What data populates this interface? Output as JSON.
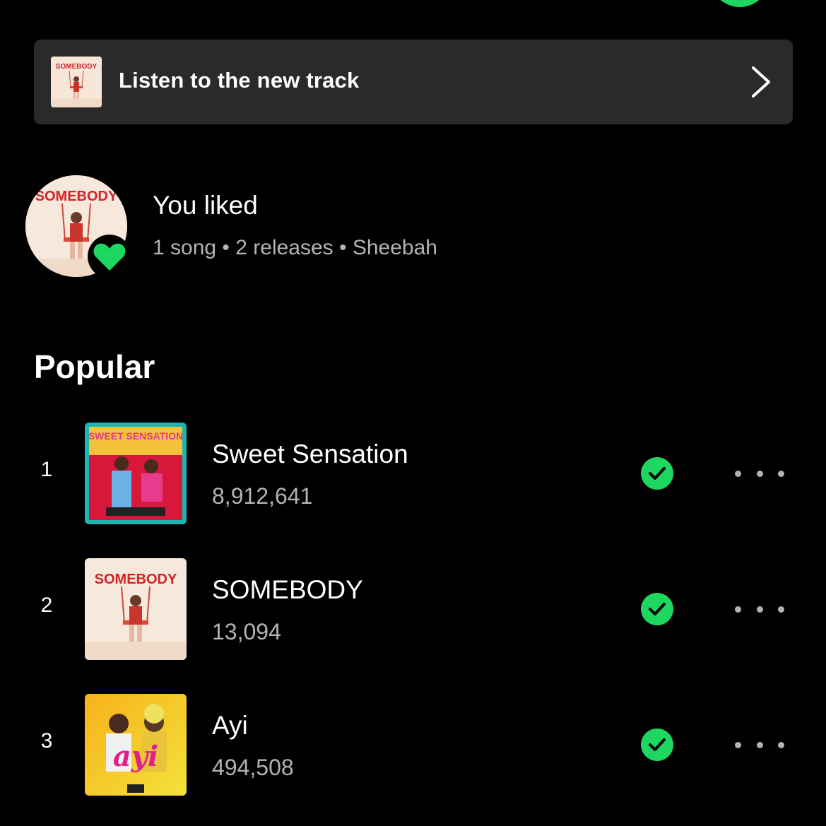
{
  "colors": {
    "background": "#000000",
    "card": "#2a2a2a",
    "accent": "#1ed760",
    "text_primary": "#ffffff",
    "text_secondary": "#b3b3b3"
  },
  "promo": {
    "title": "Listen to the new track",
    "cover_text": "SOMEBODY",
    "icon": "chevron-right-icon"
  },
  "liked": {
    "title": "You liked",
    "subtitle": "1 song • 2 releases • Sheebah",
    "cover_text": "SOMEBODY",
    "icon": "heart-icon"
  },
  "popular": {
    "heading": "Popular",
    "tracks": [
      {
        "rank": "1",
        "title": "Sweet Sensation",
        "plays": "8,912,641",
        "saved": true,
        "cover_text": "SWEET SENSATION"
      },
      {
        "rank": "2",
        "title": "SOMEBODY",
        "plays": "13,094",
        "saved": true,
        "cover_text": "SOMEBODY"
      },
      {
        "rank": "3",
        "title": "Ayi",
        "plays": "494,508",
        "saved": true,
        "cover_text": "ayi"
      }
    ]
  }
}
